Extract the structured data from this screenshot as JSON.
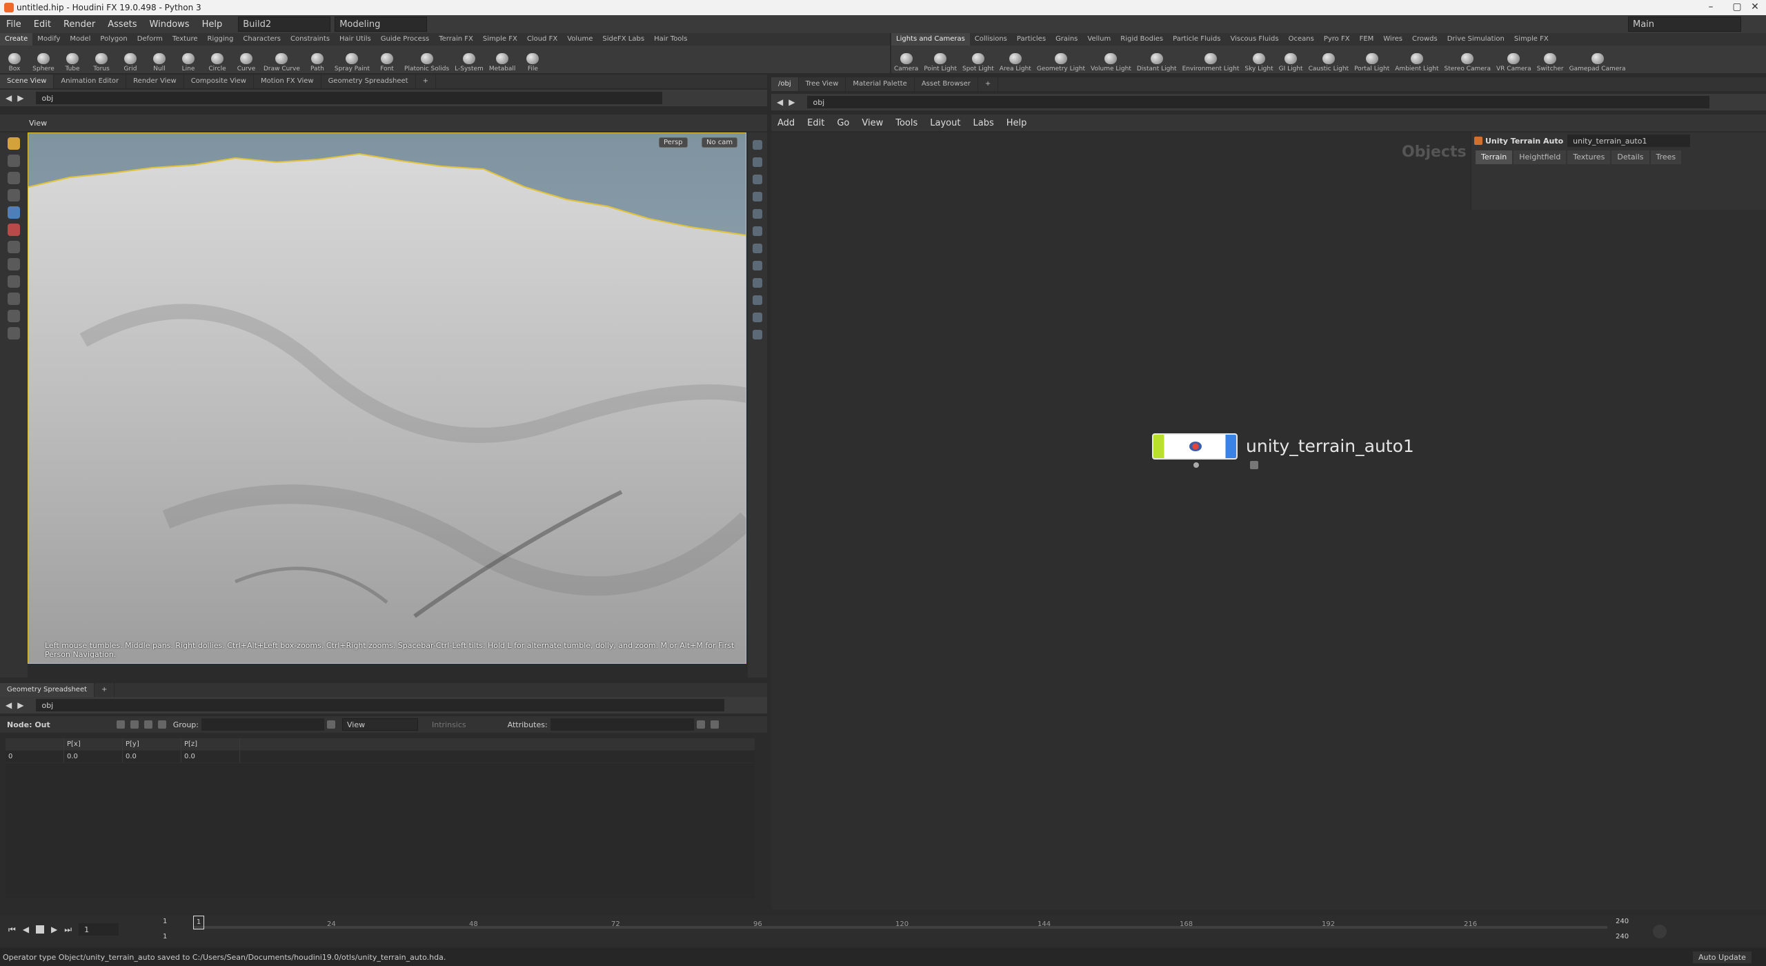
{
  "window": {
    "title": "untitled.hip - Houdini FX 19.0.498 - Python 3"
  },
  "menubar": {
    "items": [
      "File",
      "Edit",
      "Render",
      "Assets",
      "Windows",
      "Help"
    ],
    "desktop": "Build2",
    "context": "Modeling",
    "main_label": "Main"
  },
  "shelf_left": {
    "tabs": [
      "Create",
      "Modify",
      "Model",
      "Polygon",
      "Deform",
      "Texture",
      "Rigging",
      "Characters",
      "Constraints",
      "Hair Utils",
      "Guide Process",
      "Terrain FX",
      "Simple FX",
      "Cloud FX",
      "Volume",
      "SideFX Labs",
      "Hair Tools"
    ],
    "tools": [
      "Box",
      "Sphere",
      "Tube",
      "Torus",
      "Grid",
      "Null",
      "Line",
      "Circle",
      "Curve",
      "Draw Curve",
      "Path",
      "Spray Paint",
      "Font",
      "Platonic Solids",
      "L-System",
      "Metaball",
      "File"
    ]
  },
  "shelf_right": {
    "tabs": [
      "Lights and Cameras",
      "Collisions",
      "Particles",
      "Grains",
      "Vellum",
      "Rigid Bodies",
      "Particle Fluids",
      "Viscous Fluids",
      "Oceans",
      "Pyro FX",
      "FEM",
      "Wires",
      "Crowds",
      "Drive Simulation",
      "Simple FX"
    ],
    "tools": [
      "Camera",
      "Point Light",
      "Spot Light",
      "Area Light",
      "Geometry Light",
      "Volume Light",
      "Distant Light",
      "Environment Light",
      "Sky Light",
      "GI Light",
      "Caustic Light",
      "Portal Light",
      "Ambient Light",
      "Stereo Camera",
      "VR Camera",
      "Switcher",
      "Gamepad Camera"
    ]
  },
  "left_pane": {
    "tabs": [
      "Scene View",
      "Animation Editor",
      "Render View",
      "Composite View",
      "Motion FX View",
      "Geometry Spreadsheet"
    ],
    "path": "obj",
    "view_label": "View",
    "persp": "Persp",
    "cam": "No cam",
    "hint": "Left mouse tumbles. Middle pans. Right dollies. Ctrl+Alt+Left box-zooms. Ctrl+Right zooms. Spacebar-Ctrl-Left tilts. Hold L for alternate tumble, dolly, and zoom.    M or Alt+M for First Person Navigation."
  },
  "spreadsheet": {
    "tab": "Geometry Spreadsheet",
    "path": "obj",
    "node_label": "Node: Out",
    "group_label": "Group:",
    "view_label": "View",
    "intrinsics_label": "Intrinsics",
    "attributes_label": "Attributes:",
    "columns": [
      "",
      "P[x]",
      "P[y]",
      "P[z]"
    ],
    "rows": [
      [
        "0",
        "0.0",
        "0.0",
        "0.0"
      ]
    ]
  },
  "right_pane": {
    "tabs": [
      "/obj",
      "Tree View",
      "Material Palette",
      "Asset Browser"
    ],
    "path": "obj",
    "menu": [
      "Add",
      "Edit",
      "Go",
      "View",
      "Tools",
      "Layout",
      "Labs",
      "Help"
    ],
    "context_label": "Objects"
  },
  "node": {
    "name": "unity_terrain_auto1"
  },
  "params": {
    "type_label": "Unity Terrain Auto",
    "node_name": "unity_terrain_auto1",
    "tabs": [
      "Terrain",
      "Heightfield",
      "Textures",
      "Details",
      "Trees"
    ]
  },
  "timeline": {
    "current_frame": "1",
    "start": "1",
    "start2": "1",
    "end": "240",
    "end2": "240",
    "ticks": [
      "24",
      "48",
      "72",
      "96",
      "120",
      "144",
      "168",
      "192",
      "216"
    ],
    "auto_update": "Auto Update"
  },
  "status": {
    "message": "Operator type Object/unity_terrain_auto saved to C:/Users/Sean/Documents/houdini19.0/otls/unity_terrain_auto.hda."
  },
  "colors": {
    "node_left": "#b9e02b",
    "node_right": "#3b82e6",
    "viewport_outline": "#e0c23a"
  }
}
